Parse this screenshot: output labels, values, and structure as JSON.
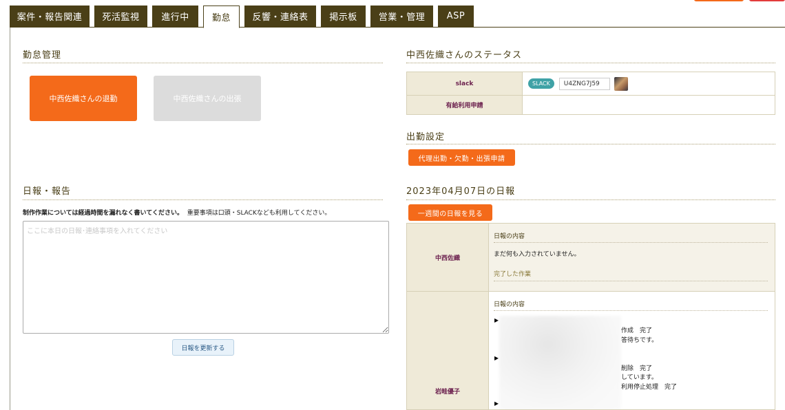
{
  "tabs": [
    {
      "label": "案件・報告関連"
    },
    {
      "label": "死活監視"
    },
    {
      "label": "進行中"
    },
    {
      "label": "勤怠"
    },
    {
      "label": "反響・連絡表"
    },
    {
      "label": "掲示板"
    },
    {
      "label": "営業・管理"
    },
    {
      "label": "ASP"
    }
  ],
  "active_tab": "勤怠",
  "attendance": {
    "title": "勤怠管理",
    "leave_button": "中西佐織さんの退勤",
    "business_trip_button": "中西佐織さんの出張"
  },
  "report": {
    "title": "日報・報告",
    "note_bold": "制作作業については経過時間を漏れなく書いてください。",
    "note_rest": "重要事項は口頭・SLACKなども利用してください。",
    "placeholder": "ここに本日の日報･連絡事項を入れてください",
    "update_button": "日報を更新する"
  },
  "status": {
    "title": "中西佐織さんのステータス",
    "slack_label": "slack",
    "slack_badge": "SLACK",
    "slack_id": "U4ZNG7J59",
    "paid_leave_label": "有給利用申請",
    "paid_leave_value": ""
  },
  "shift": {
    "title": "出勤設定",
    "proxy_button": "代理出勤・欠勤・出張申請"
  },
  "daily": {
    "title": "2023年04月07日の日報",
    "week_button": "一週間の日報を見る",
    "entries": [
      {
        "name": "中西佐織",
        "content_heading": "日報の内容",
        "content": "まだ何も入力されていません。",
        "done_heading": "完了した作業"
      },
      {
        "name": "岩畦優子",
        "content_heading": "日報の内容",
        "lines": [
          "作成　完了",
          "答待ちです。",
          "削除　完了",
          "しています。",
          "利用停止処理　完了"
        ]
      }
    ]
  },
  "colors": {
    "tab_bg": "#4a3f17",
    "accent_orange": "#f46a1a",
    "label_bg": "#efead8",
    "label_text": "#6b1f4d",
    "slack_badge": "#3fa2a6"
  }
}
